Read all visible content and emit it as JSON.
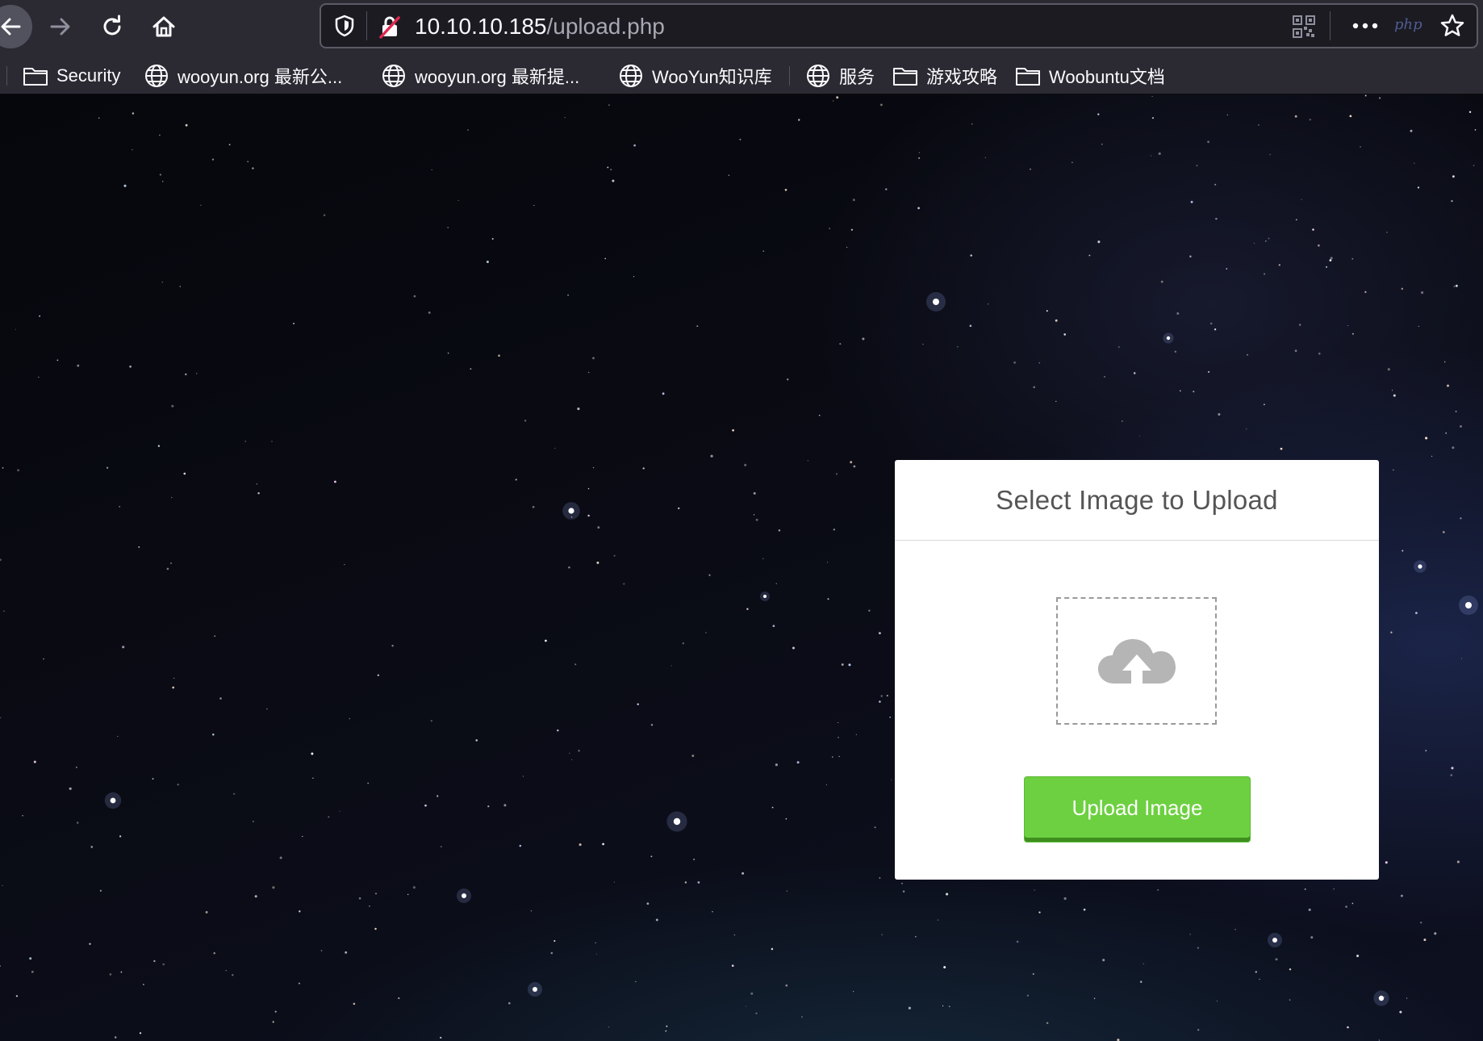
{
  "browser": {
    "nav": {
      "back_icon": "arrow-left-icon",
      "forward_icon": "arrow-right-icon",
      "reload_icon": "reload-icon",
      "home_icon": "home-icon"
    },
    "urlbar": {
      "host": "10.10.10.185",
      "path": "/upload.php",
      "icons": [
        "shield-icon",
        "insecure-lock-icon",
        "qr-code-icon",
        "more-icon",
        "php-extension-icon",
        "star-icon"
      ],
      "php_badge": "php"
    },
    "bookmarks": [
      {
        "label": "Security",
        "icon": "folder-icon"
      },
      {
        "label": "wooyun.org 最新公...",
        "icon": "globe-icon"
      },
      {
        "label": "wooyun.org 最新提...",
        "icon": "globe-icon"
      },
      {
        "label": "WooYun知识库",
        "icon": "globe-icon"
      },
      {
        "label": "服务",
        "icon": "globe-icon"
      },
      {
        "label": "游戏攻略",
        "icon": "folder-icon"
      },
      {
        "label": "Woobuntu文档",
        "icon": "folder-icon"
      }
    ]
  },
  "page": {
    "card": {
      "title": "Select Image to Upload",
      "dropzone_icon": "cloud-upload-icon",
      "button_label": "Upload Image"
    }
  },
  "colors": {
    "chrome_bg": "#2b2a33",
    "urlbar_bg": "#1c1b22",
    "button_green": "#6dd040",
    "card_bg": "#ffffff",
    "title_text": "#555555",
    "upload_icon": "#b5b5b5"
  }
}
